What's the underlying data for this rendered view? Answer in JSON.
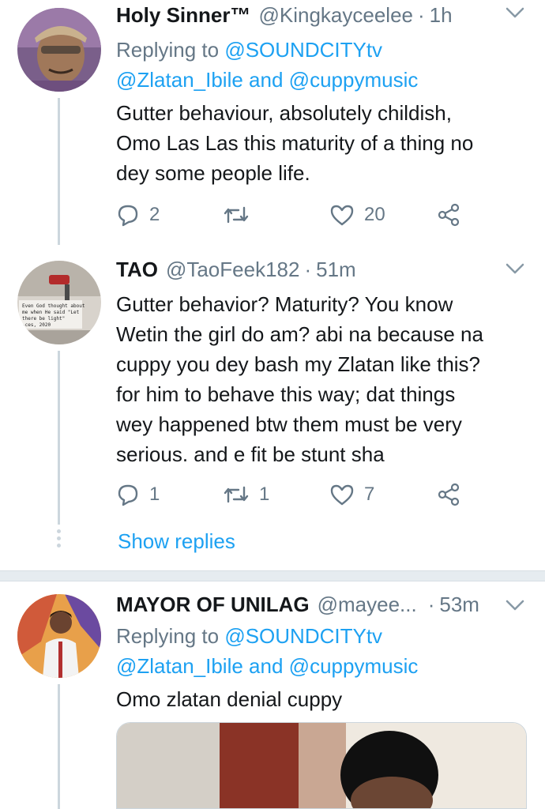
{
  "tweets": [
    {
      "display_name": "Holy Sinner™",
      "handle": "@Kingkayceelee",
      "sep": "·",
      "time": "1h",
      "replying_label": "Replying to",
      "replying_first": "@SOUNDCITYtv",
      "replying_second": "@Zlatan_Ibile",
      "replying_and": "and",
      "replying_third": "@cuppymusic",
      "text": "Gutter behaviour, absolutely childish,\nOmo Las Las this maturity of a thing no\ndey some people life.",
      "reply_count": "2",
      "retweet_count": "",
      "like_count": "20"
    },
    {
      "display_name": "TAO",
      "handle": "@TaoFeek182",
      "sep": "·",
      "time": "51m",
      "text": "Gutter behavior? Maturity? You know\nWetin the girl do am? abi na because na\ncuppy you dey bash my Zlatan like this?\nfor him to behave this way; dat things\nwey happened btw them must be very\nserious. and e fit be stunt sha",
      "reply_count": "1",
      "retweet_count": "1",
      "like_count": "7",
      "avatar_text": "Even God thought about\nme when He said \"Let\nthere be light\"\n-ces, 2020"
    },
    {
      "display_name": "MAYOR OF UNILAG",
      "handle": "@mayee...",
      "sep": "·",
      "time": "53m",
      "replying_label": "Replying to",
      "replying_first": "@SOUNDCITYtv",
      "replying_second": "@Zlatan_Ibile",
      "replying_and": "and",
      "replying_third": "@cuppymusic",
      "text": "Omo zlatan denial cuppy"
    }
  ],
  "show_replies": "Show replies",
  "colors": {
    "link": "#1da1f2",
    "secondary": "#657786",
    "primary": "#14171a",
    "thread_line": "#ccd6dd"
  },
  "icons": [
    "reply-icon",
    "retweet-icon",
    "like-icon",
    "share-icon",
    "chevron-down-icon"
  ]
}
